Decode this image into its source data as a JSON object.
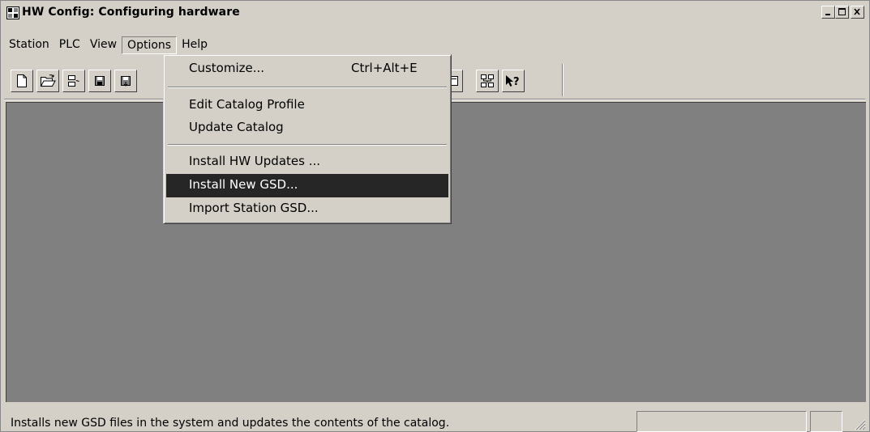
{
  "window": {
    "title": "HW Config: Configuring hardware"
  },
  "menubar": {
    "items": [
      "Station",
      "PLC",
      "View",
      "Options",
      "Help"
    ],
    "active": "Options"
  },
  "options_menu": {
    "items": [
      {
        "label": "Customize...",
        "shortcut": "Ctrl+Alt+E"
      },
      {
        "label": "Edit Catalog Profile"
      },
      {
        "label": "Update Catalog"
      },
      {
        "label": "Install HW Updates ..."
      },
      {
        "label": "Install New GSD..."
      },
      {
        "label": "Import Station GSD..."
      }
    ],
    "highlighted": "Install New GSD..."
  },
  "toolbar": {
    "icons": [
      "new-icon",
      "open-icon",
      "station-icon",
      "save-icon",
      "save-compile-icon",
      "module-icon",
      "network-icon",
      "whats-this-icon"
    ]
  },
  "statusbar": {
    "text": "Installs new GSD files in the system and updates the contents of the catalog."
  },
  "colors": {
    "face": "#d4d0c8",
    "workspace": "#808080",
    "highlight": "#262626"
  }
}
